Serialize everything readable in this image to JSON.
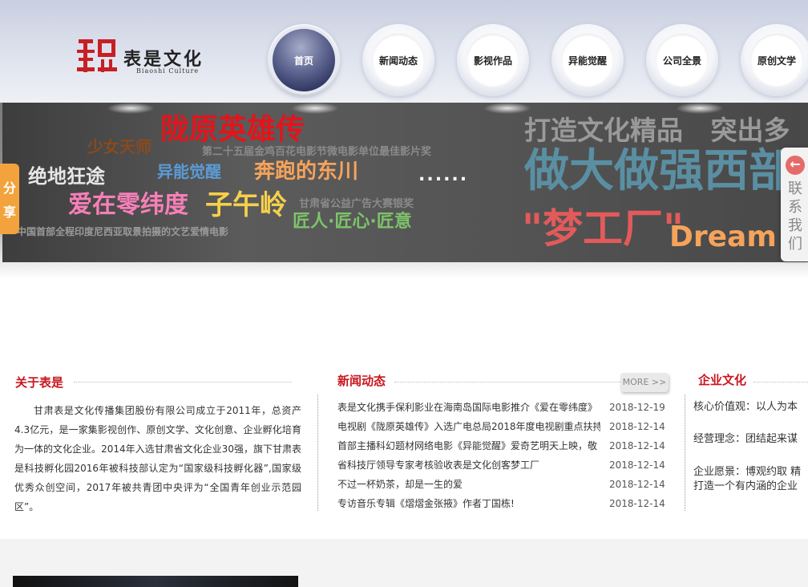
{
  "header": {
    "logo_cn": "表是文化",
    "logo_en": "Biaoshi Culture",
    "nav": [
      {
        "label": "首页",
        "active": true
      },
      {
        "label": "新闻动态"
      },
      {
        "label": "影视作品"
      },
      {
        "label": "异能觉醒"
      },
      {
        "label": "公司全景"
      },
      {
        "label": "原创文学"
      }
    ]
  },
  "banner": {
    "longyuan": "陇原英雄传",
    "shaonv": "少女天师",
    "award1": "第二十五届金鸡百花电影节微电影单位最佳影片奖",
    "juedi": "绝地狂途",
    "yineng": "异能觉醒",
    "benpao": "奔跑的东川",
    "dots": "......",
    "aizai": "爱在零纬度",
    "ziwu": "子午岭",
    "award2": "甘肃省公益广告大赛银奖",
    "jiangren": "匠人·匠心·匠意",
    "yindu": "中国首部全程印度尼西亚取景拍摄的文艺爱情电影",
    "slogan1": "打造文化精品   突出多",
    "slogan2": "做大做强西部",
    "slogan3": "\"梦工厂\"",
    "slogan4": "Dream",
    "colors": {
      "red": "#e3141b",
      "blue": "#5b9bd5",
      "orange": "#f6a35b",
      "pink": "#f77fb8",
      "yellow": "#f5d04b",
      "green": "#7dc36a",
      "gray": "#9a9a9a",
      "teal": "#5a8fa3"
    }
  },
  "side": {
    "share": [
      "分",
      "享"
    ],
    "contact_arrow": "←",
    "contact": [
      "联",
      "系",
      "我",
      "们"
    ]
  },
  "about": {
    "title": "关于表是",
    "text": "甘肃表是文化传播集团股份有限公司成立于2011年，总资产4.3亿元，是一家集影视创作、原创文学、文化创意、企业孵化培育为一体的文化企业。2014年入选甘肃省文化企业30强，旗下甘肃表是科技孵化园2016年被科技部认定为“国家级科技孵化器”,国家级优秀众创空间，2017年被共青团中央评为“全国青年创业示范园区”。"
  },
  "news": {
    "title": "新闻动态",
    "more": "MORE >>",
    "items": [
      {
        "title": "表是文化携手保利影业在海南岛国际电影推介《爱在零纬度》",
        "date": "2018-12-19"
      },
      {
        "title": "电视剧《陇原英雄传》入选广电总局2018年度电视剧重点扶持",
        "date": "2018-12-14"
      },
      {
        "title": "首部主播科幻题材网络电影《异能觉醒》爱奇艺明天上映，敬",
        "date": "2018-12-14"
      },
      {
        "title": "省科技厅领导专家考核验收表是文化创客梦工厂",
        "date": "2018-12-14"
      },
      {
        "title": "不过一杯奶茶，却是一生的爱",
        "date": "2018-12-14"
      },
      {
        "title": "专访音乐专辑《熠熠金张掖》作者丁国栋!",
        "date": "2018-12-14"
      }
    ]
  },
  "culture": {
    "title": "企业文化",
    "lines": [
      "核心价值观：以人为本",
      "经营理念：团结起来谋",
      "企业愿景：博观约取 精",
      "打造一个有内涵的企业"
    ]
  }
}
